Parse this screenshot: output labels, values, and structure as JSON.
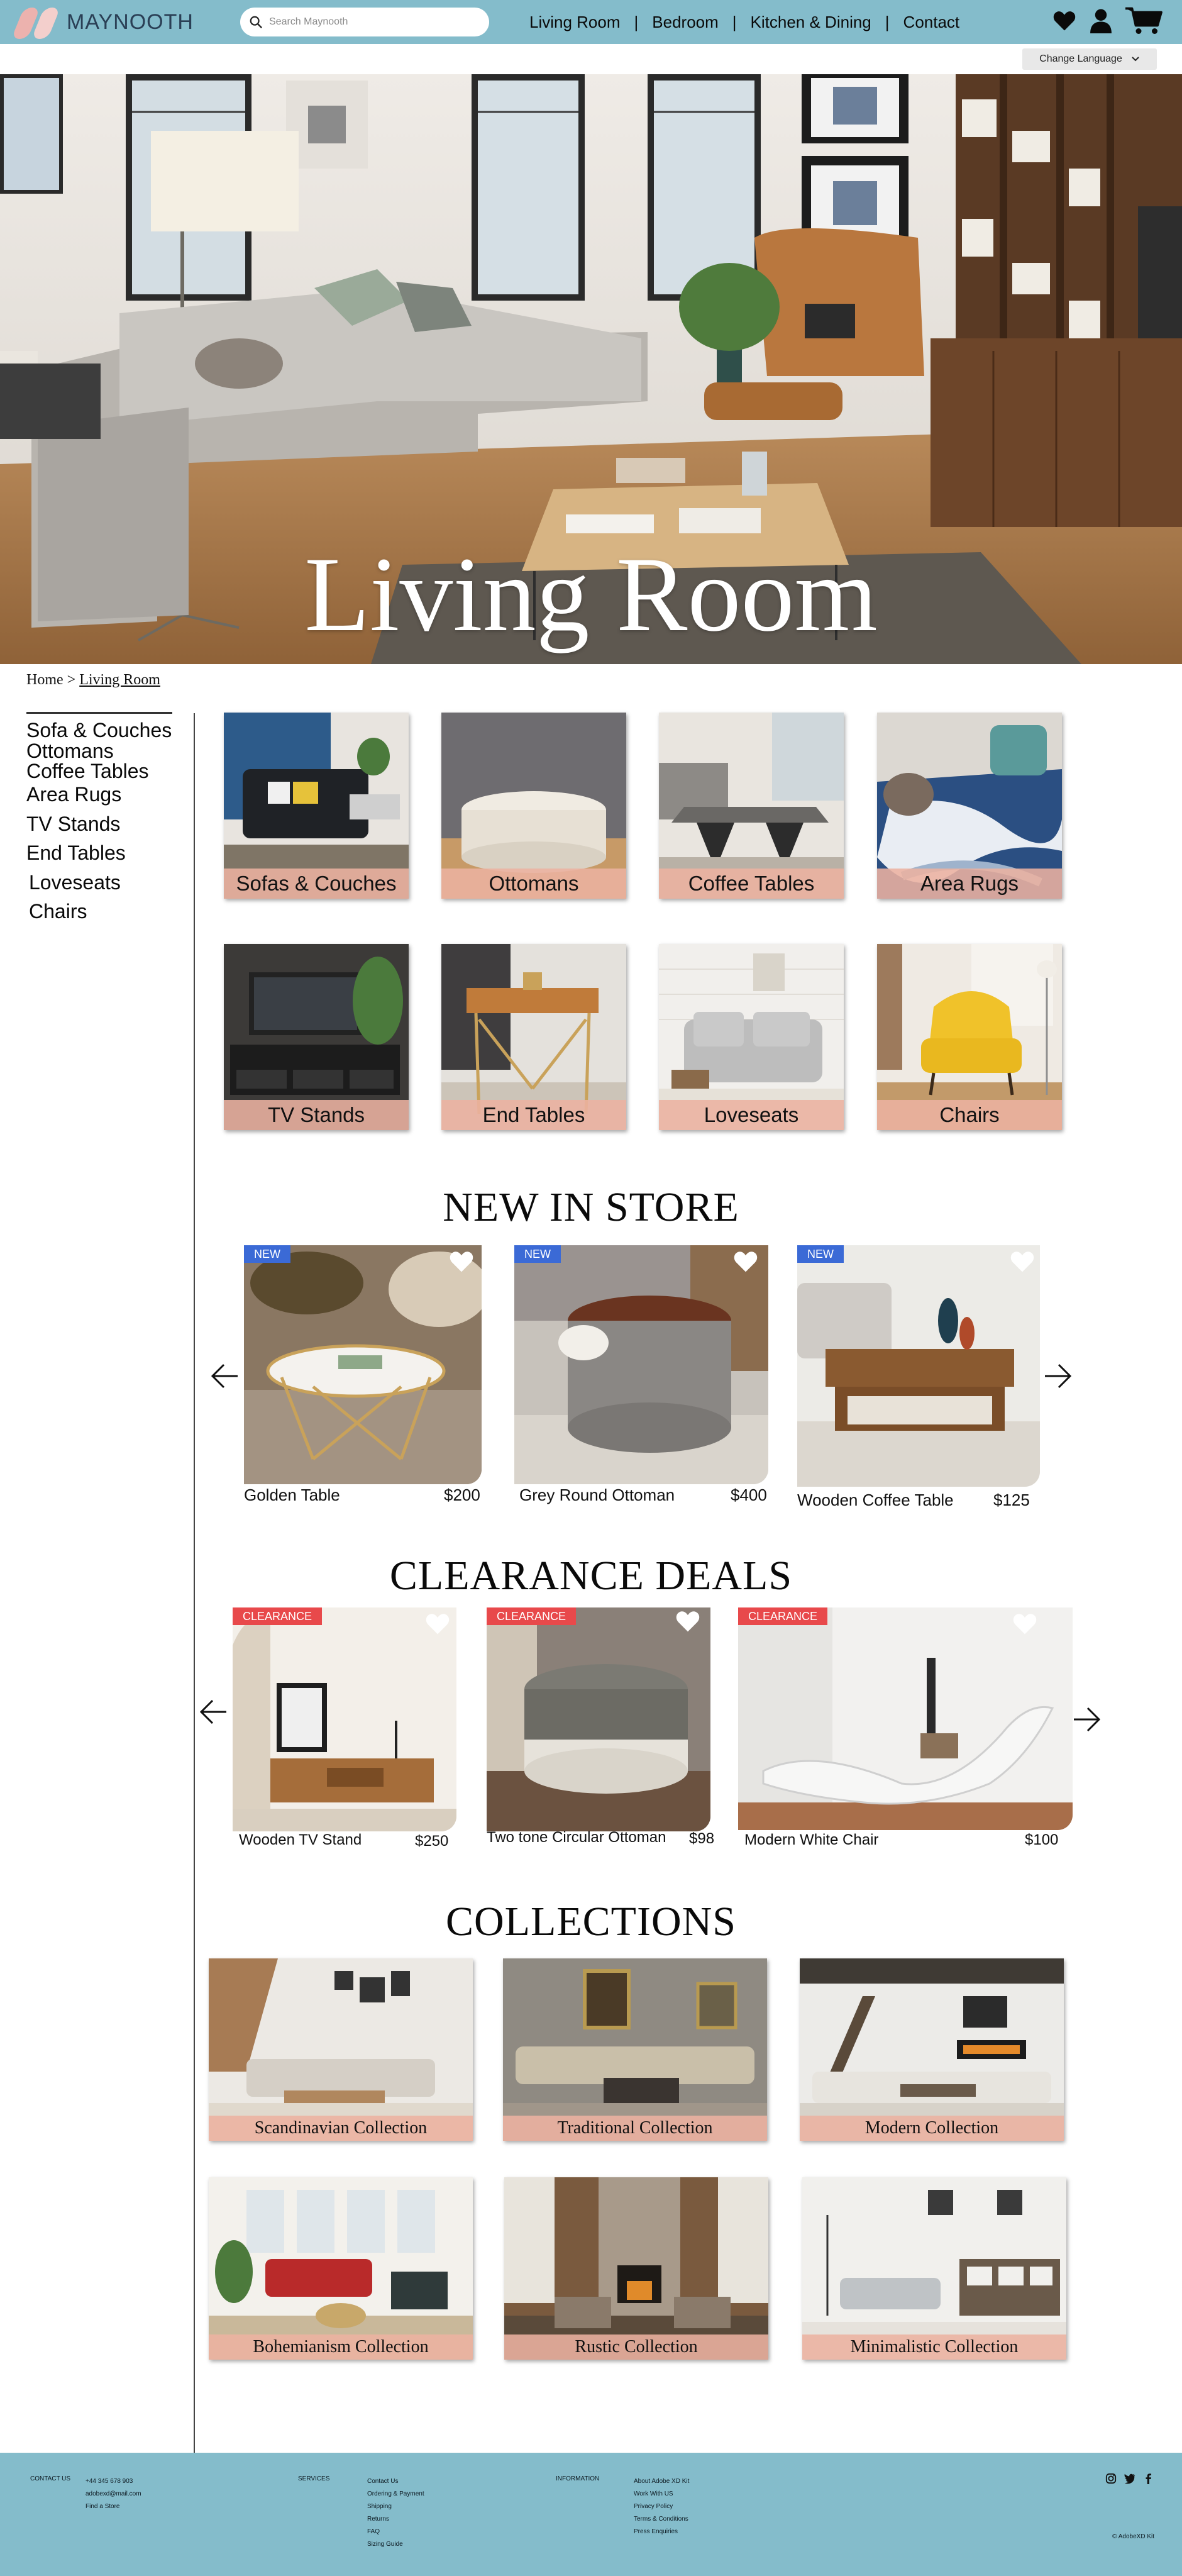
{
  "brand": {
    "name": "MAYNOOTH"
  },
  "search": {
    "placeholder": "Search Maynooth"
  },
  "nav": {
    "items": [
      "Living Room",
      "Bedroom",
      "Kitchen & Dining",
      "Contact"
    ],
    "separator": "|"
  },
  "header_icons": [
    "heart-icon",
    "user-icon",
    "cart-icon"
  ],
  "language": {
    "label": "Change Language"
  },
  "hero": {
    "title": "Living Room"
  },
  "breadcrumb": {
    "home": "Home",
    "separator": ">",
    "current": "Living Room"
  },
  "sidebar": {
    "items": [
      "Sofa & Couches",
      "Ottomans",
      "Coffee Tables",
      "Area Rugs",
      "TV Stands",
      "End Tables",
      "Loveseats",
      "Chairs"
    ]
  },
  "categories": [
    "Sofas & Couches",
    "Ottomans",
    "Coffee Tables",
    "Area Rugs",
    "TV Stands",
    "End Tables",
    "Loveseats",
    "Chairs"
  ],
  "new_in_store": {
    "title": "NEW IN STORE",
    "badge": "NEW",
    "products": [
      {
        "name": "Golden Table",
        "price": "$200"
      },
      {
        "name": "Grey Round Ottoman",
        "price": "$400"
      },
      {
        "name": "Wooden Coffee Table",
        "price": "$125"
      }
    ]
  },
  "clearance": {
    "title": "CLEARANCE DEALS",
    "badge": "CLEARANCE",
    "products": [
      {
        "name": "Wooden TV Stand",
        "price": "$250"
      },
      {
        "name": "Two tone Circular Ottoman",
        "price": "$98"
      },
      {
        "name": "Modern White Chair",
        "price": "$100"
      }
    ]
  },
  "collections": {
    "title": "COLLECTIONS",
    "items": [
      "Scandinavian Collection",
      "Traditional Collection",
      "Modern Collection",
      "Bohemianism Collection",
      "Rustic Collection",
      "Minimalistic Collection"
    ]
  },
  "footer": {
    "contact_heading": "CONTACT US",
    "contact": [
      "+44 345 678 903",
      "adobexd@mail.com",
      "Find a Store"
    ],
    "services_heading": "SERVICES",
    "services": [
      "Contact Us",
      "Ordering & Payment",
      "Shipping",
      "Returns",
      "FAQ",
      "Sizing Guide"
    ],
    "info_heading": "INFORMATION",
    "info": [
      "About Adobe XD Kit",
      "Work With US",
      "Privacy Policy",
      "Terms & Conditions",
      "Press Enquiries"
    ],
    "social": [
      "instagram-icon",
      "twitter-icon",
      "facebook-icon"
    ],
    "copyright": "© AdobeXD Kit"
  },
  "colors": {
    "topbar": "#84bccb",
    "label_band": "#ecb2a0",
    "new_badge": "#3b6ad6",
    "clearance_badge": "#e8494b"
  }
}
